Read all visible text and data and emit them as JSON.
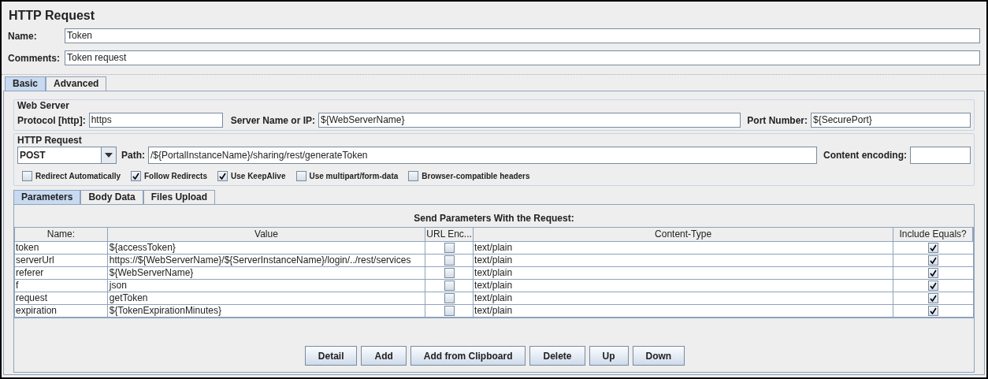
{
  "title": "HTTP Request",
  "name_field": {
    "label": "Name:",
    "value": "Token"
  },
  "comments_field": {
    "label": "Comments:",
    "value": "Token request"
  },
  "tabs": [
    {
      "label": "Basic",
      "selected": true
    },
    {
      "label": "Advanced",
      "selected": false
    }
  ],
  "web_server": {
    "legend": "Web Server",
    "protocol": {
      "label": "Protocol [http]:",
      "value": "https"
    },
    "server": {
      "label": "Server Name or IP:",
      "value": "${WebServerName}"
    },
    "port": {
      "label": "Port Number:",
      "value": "${SecurePort}"
    }
  },
  "http_request": {
    "legend": "HTTP Request",
    "method": "POST",
    "path": {
      "label": "Path:",
      "value": "/${PortalInstanceName}/sharing/rest/generateToken"
    },
    "encoding": {
      "label": "Content encoding:"
    },
    "options": [
      {
        "label": "Redirect Automatically",
        "checked": false
      },
      {
        "label": "Follow Redirects",
        "checked": true
      },
      {
        "label": "Use KeepAlive",
        "checked": true
      },
      {
        "label": "Use multipart/form-data",
        "checked": false
      },
      {
        "label": "Browser-compatible headers",
        "checked": false
      }
    ]
  },
  "sub_tabs": [
    {
      "label": "Parameters",
      "selected": true
    },
    {
      "label": "Body Data",
      "selected": false
    },
    {
      "label": "Files Upload",
      "selected": false
    }
  ],
  "table": {
    "caption": "Send Parameters With the Request:",
    "columns": [
      "Name:",
      "Value",
      "URL Enc...",
      "Content-Type",
      "Include Equals?"
    ],
    "rows": [
      {
        "name": "token",
        "value": "${accessToken}",
        "url_encode": false,
        "content_type": "text/plain",
        "include_equals": true
      },
      {
        "name": "serverUrl",
        "value": "https://${WebServerName}/${ServerInstanceName}/login/../rest/services",
        "url_encode": false,
        "content_type": "text/plain",
        "include_equals": true
      },
      {
        "name": "referer",
        "value": "${WebServerName}",
        "url_encode": false,
        "content_type": "text/plain",
        "include_equals": true
      },
      {
        "name": "f",
        "value": "json",
        "url_encode": false,
        "content_type": "text/plain",
        "include_equals": true
      },
      {
        "name": "request",
        "value": "getToken",
        "url_encode": false,
        "content_type": "text/plain",
        "include_equals": true
      },
      {
        "name": "expiration",
        "value": "${TokenExpirationMinutes}",
        "url_encode": false,
        "content_type": "text/plain",
        "include_equals": true
      }
    ]
  },
  "buttons": [
    "Detail",
    "Add",
    "Add from Clipboard",
    "Delete",
    "Up",
    "Down"
  ]
}
